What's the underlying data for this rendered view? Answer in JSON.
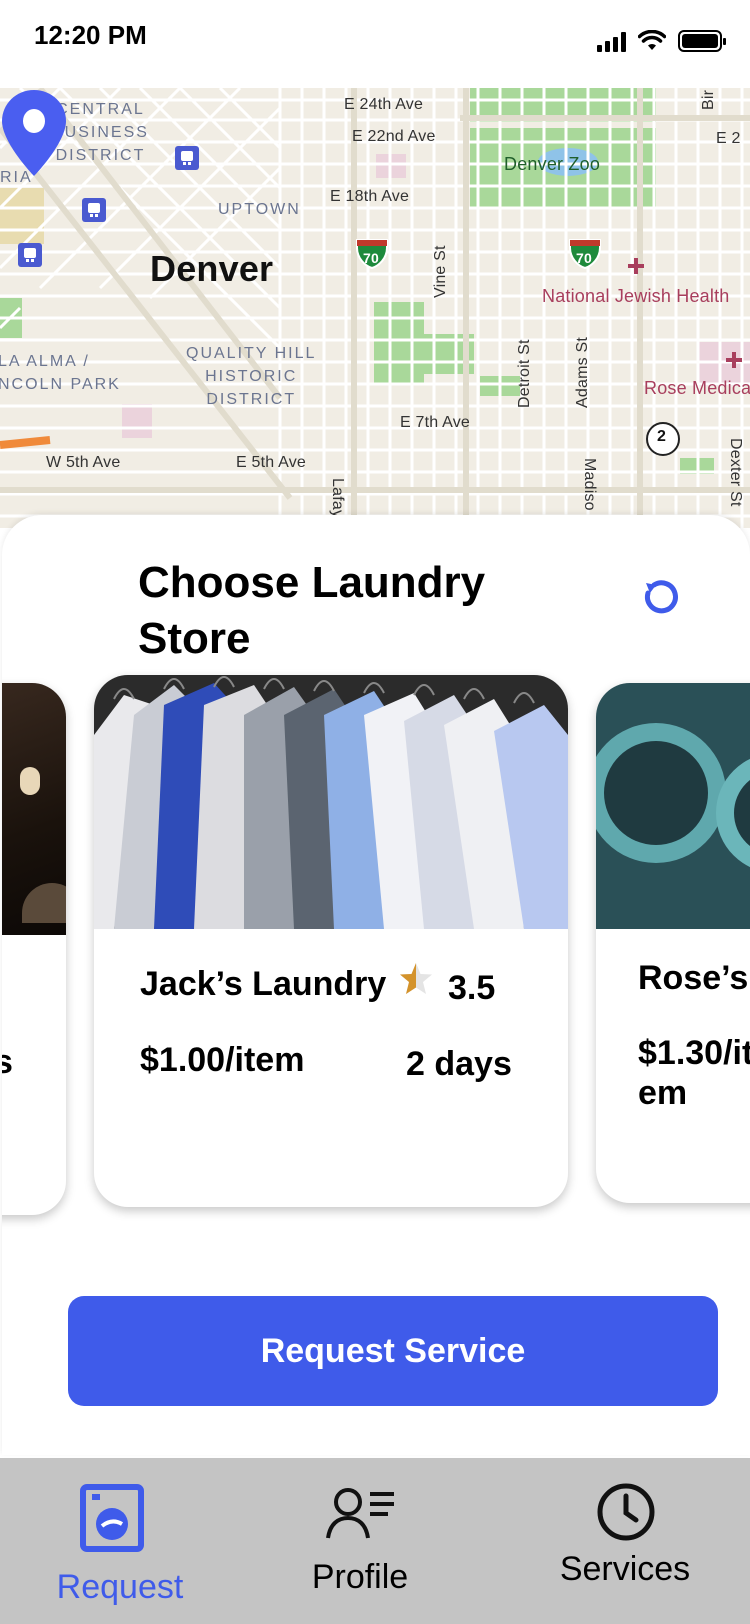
{
  "status_bar": {
    "time": "12:20 PM"
  },
  "map": {
    "city": "Denver",
    "districts": {
      "cbd": "CENTRAL\nBUSINESS\nDISTRICT",
      "uptown": "UPTOWN",
      "quality_hill": "QUALITY HILL\nHISTORIC\nDISTRICT",
      "la_alma": "LA ALMA /\nNCOLN PARK"
    },
    "streets": {
      "e24": "E 24th Ave",
      "e22": "E 22nd Ave",
      "e18": "E 18th Ave",
      "e7": "E 7th Ave",
      "w5": "W 5th Ave",
      "e5": "E 5th Ave",
      "vine": "Vine St",
      "detroit": "Detroit St",
      "adams": "Adams St",
      "lafayette": "Lafayette St",
      "madison": "Madiso",
      "dexter": "Dexter St",
      "bir": "Bir",
      "ria": "RIA",
      "e2": "E 2"
    },
    "pois": {
      "zoo": "Denver Zoo",
      "national_jewish": "National Jewish Health",
      "rose_medical": "Rose Medica"
    },
    "shields": {
      "i70_a": "70",
      "i70_b": "70",
      "route2": "2"
    }
  },
  "sheet": {
    "title": "Choose Laundry Store",
    "cards": [
      {
        "name": "",
        "price": "s"
      },
      {
        "name": "Jack’s Laundry",
        "rating": "3.5",
        "rating_value": 3.5,
        "price": "$1.00/item",
        "days": "2 days"
      },
      {
        "name": "Rose’s",
        "price": "$1.30/item"
      }
    ],
    "request_button": "Request Service"
  },
  "nav": {
    "request": "Request",
    "profile": "Profile",
    "services": "Services"
  },
  "colors": {
    "accent": "#3f5bea",
    "nav_bg": "#c4c4c4",
    "star": "#d4932b"
  }
}
